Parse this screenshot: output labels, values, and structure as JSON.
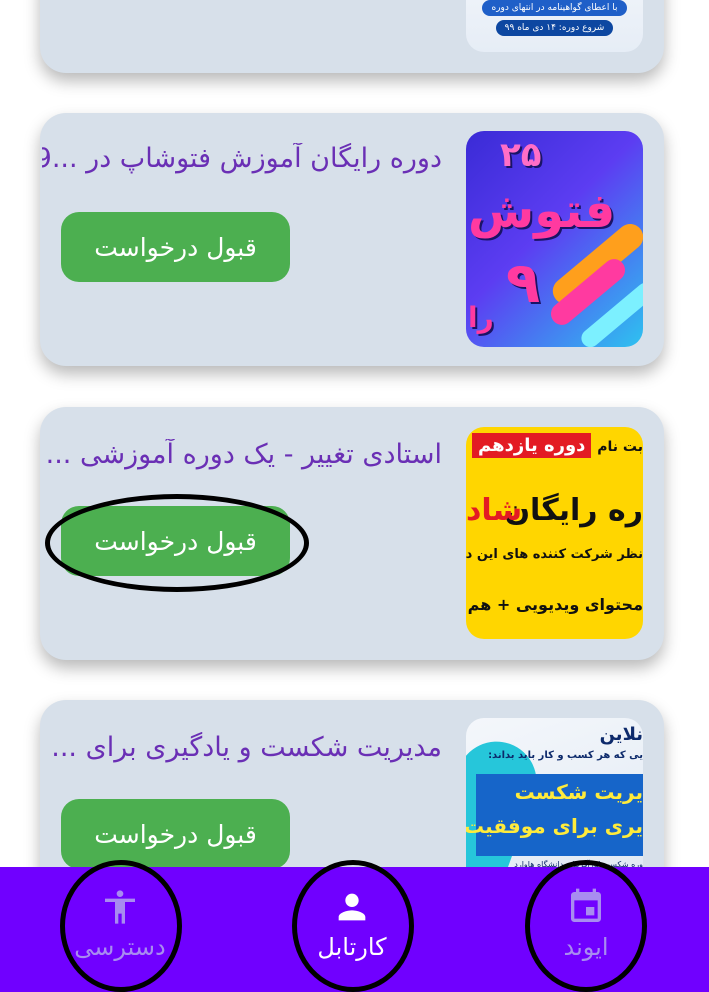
{
  "cards": [
    {
      "title": "",
      "thumb_lines": [
        "با اعطای گواهینامه در انتهای دوره",
        "شروع دوره: ۱۴ دی ماه ۹۹"
      ]
    },
    {
      "title": "دوره رایگان آموزش فتوشاپ در ...9",
      "button_label": "قبول درخواست",
      "thumb_lines": [
        "۲۵",
        "فتوش",
        "۹",
        "را"
      ]
    },
    {
      "title": "استادی تغییر - یک دوره آموزشی ...",
      "button_label": "قبول درخواست",
      "thumb_lines": [
        "دوره یازدهم",
        "بت نام",
        "ره رایگان",
        "شاد",
        "نظر شرکت کننده های این دور",
        "محتوای ویدیویی + هم"
      ]
    },
    {
      "title": "مدیریت شکست و یادگیری برای ...",
      "button_label": "قبول درخواست",
      "thumb_lines": [
        "نلاین",
        "یی که هر کسب و کار باید بداند:",
        "یریت شکست",
        "یری برای موفقیت",
        "وره شکست کارآفرینانه دانشگاه هاوارد"
      ]
    }
  ],
  "bottom_nav": {
    "items": [
      {
        "label": "دسترسی",
        "icon": "accessibility-icon"
      },
      {
        "label": "کارتابل",
        "icon": "person-icon"
      },
      {
        "label": "ایوند",
        "icon": "calendar-icon"
      }
    ]
  },
  "colors": {
    "nav_bg": "#7000ff",
    "card_bg": "#d7e0ea",
    "title": "#6a2fb5",
    "button": "#4caf50"
  }
}
